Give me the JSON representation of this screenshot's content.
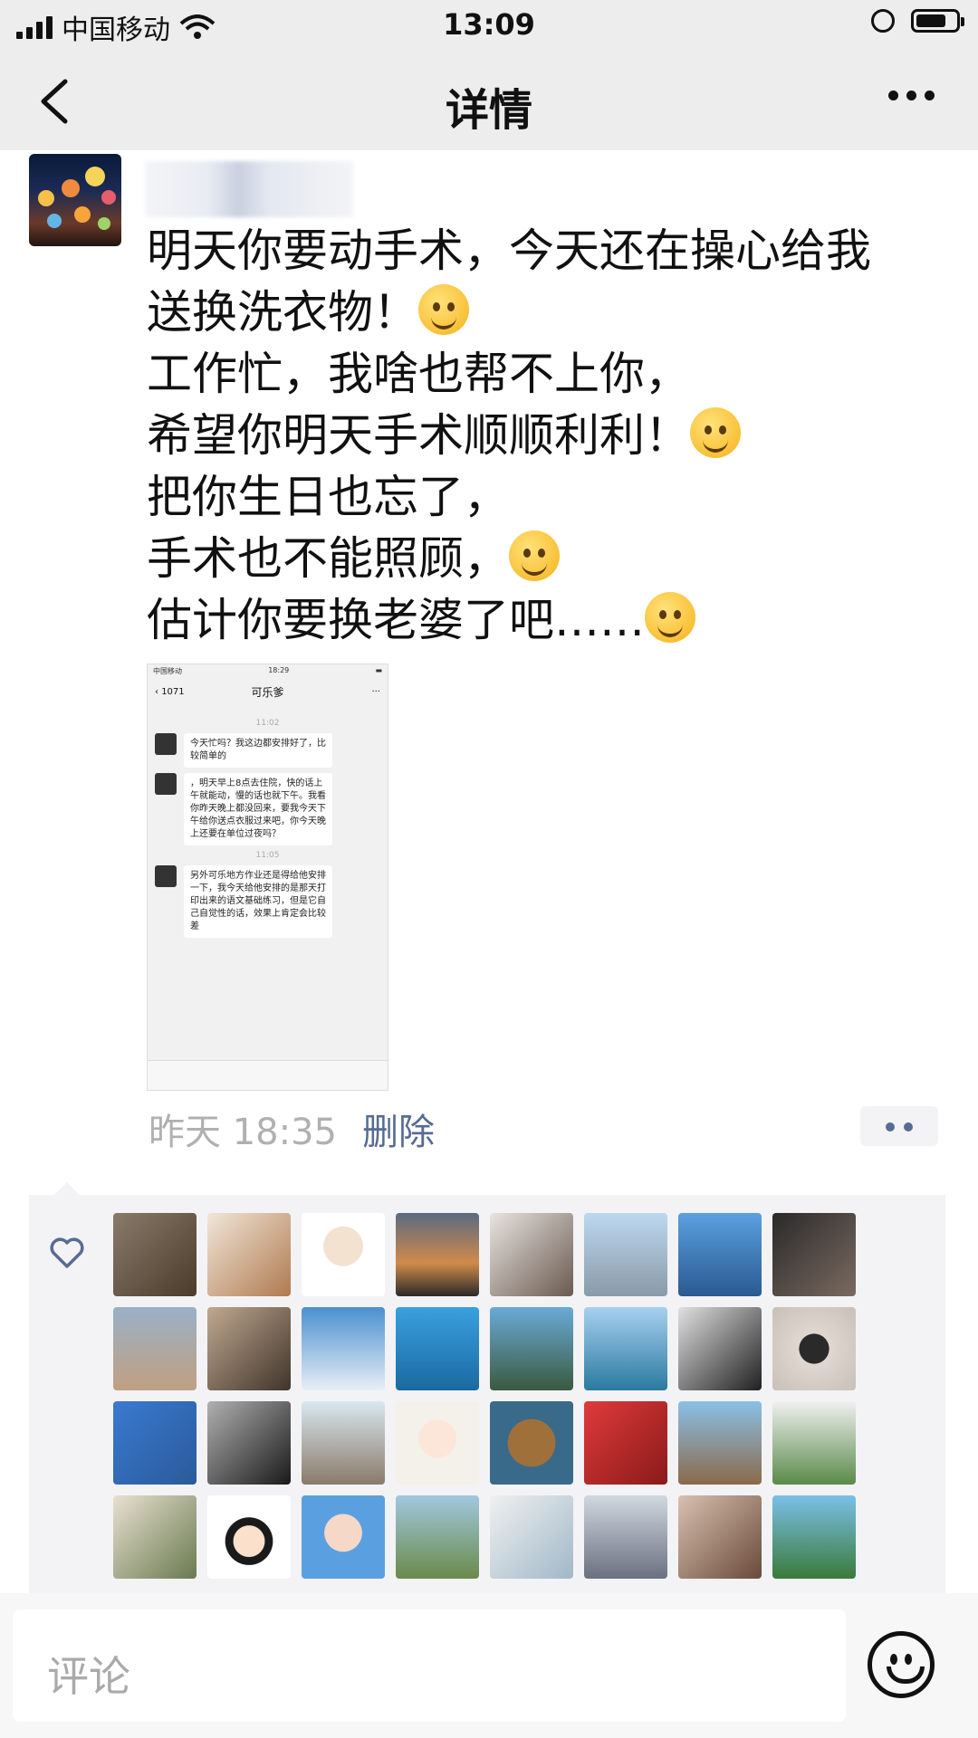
{
  "status_bar": {
    "carrier": "中国移动",
    "time": "13:09"
  },
  "nav": {
    "title": "详情"
  },
  "post": {
    "lines": [
      "明天你要动手术，今天还在操心给我",
      "送换洗衣物！",
      "工作忙，我啥也帮不上你，",
      "希望你明天手术顺顺利利！",
      "把你生日也忘了，",
      "手术也不能照顾，",
      "估计你要换老婆了吧……"
    ],
    "emojis": [
      "laughing-crying-emoji",
      "hug-emoji",
      "crying-emoji",
      "grin-emoji"
    ],
    "time": "昨天 18:35",
    "delete_label": "删除"
  },
  "screenshot": {
    "status_left": "中国移动",
    "status_time": "18:29",
    "back_label": "1071",
    "title": "可乐爹",
    "time1": "11:02",
    "msg1": "今天忙吗？我这边都安排好了，比较简单的",
    "msg2": "，明天早上8点去住院，快的话上午就能动，慢的话也就下午。我看你昨天晚上都没回来，要我今天下午给你送点衣服过来吧，你今天晚上还要在单位过夜吗？",
    "time2": "11:05",
    "msg3": "另外可乐地方作业还是得给他安排一下，我今天给他安排的是那天打印出来的语文基础练习，但是它自己自觉性的话，效果上肯定会比较差"
  },
  "comment": {
    "placeholder": "评论"
  },
  "colors": {
    "link": "#576b95",
    "bar_bg": "#ededed",
    "likes_bg": "#f3f3f5"
  }
}
